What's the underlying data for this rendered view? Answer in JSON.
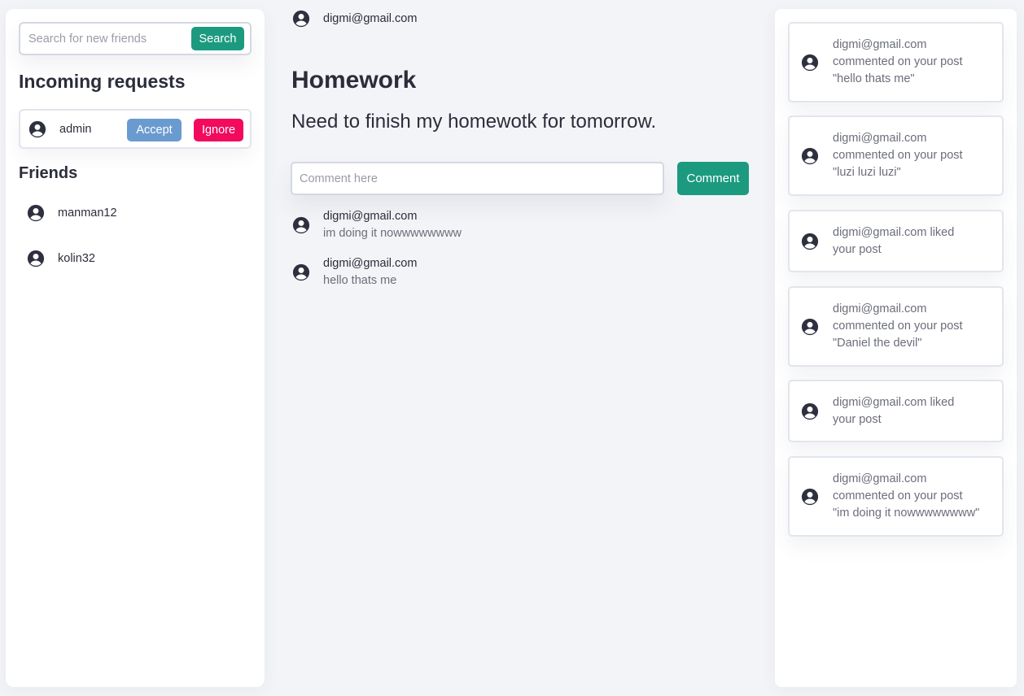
{
  "sidebar": {
    "search": {
      "placeholder": "Search for new friends",
      "button_label": "Search"
    },
    "incoming_heading": "Incoming requests",
    "requests": [
      {
        "name": "admin",
        "accept_label": "Accept",
        "ignore_label": "Ignore"
      }
    ],
    "friends_heading": "Friends",
    "friends": [
      {
        "name": "manman12"
      },
      {
        "name": "kolin32"
      }
    ]
  },
  "post": {
    "author": "digmi@gmail.com",
    "title": "Homework",
    "body": "Need to finish my homewotk for tomorrow.",
    "comment_placeholder": "Comment here",
    "comment_button_label": "Comment",
    "comments": [
      {
        "author": "digmi@gmail.com",
        "text": "im doing it nowwwwwwww"
      },
      {
        "author": "digmi@gmail.com",
        "text": "hello thats me"
      }
    ]
  },
  "notifications": [
    {
      "lines": [
        "digmi@gmail.com",
        "commented on your post",
        "\"hello thats me\""
      ]
    },
    {
      "lines": [
        "digmi@gmail.com",
        "commented on your post",
        "\"luzi luzi luzi\""
      ]
    },
    {
      "lines": [
        "digmi@gmail.com liked",
        "your post"
      ]
    },
    {
      "lines": [
        "digmi@gmail.com",
        "commented on your post",
        "\"Daniel the devil\""
      ]
    },
    {
      "lines": [
        "digmi@gmail.com liked",
        "your post"
      ]
    },
    {
      "lines": [
        "digmi@gmail.com",
        "commented on your post",
        "\"im doing it nowwwwwwww\""
      ]
    }
  ],
  "icons": {
    "user": "user-circle-icon"
  },
  "colors": {
    "primary": "#1c9a7f",
    "accept": "#6a9bd0",
    "ignore": "#f20a5d",
    "text": "#2b2d3a"
  }
}
